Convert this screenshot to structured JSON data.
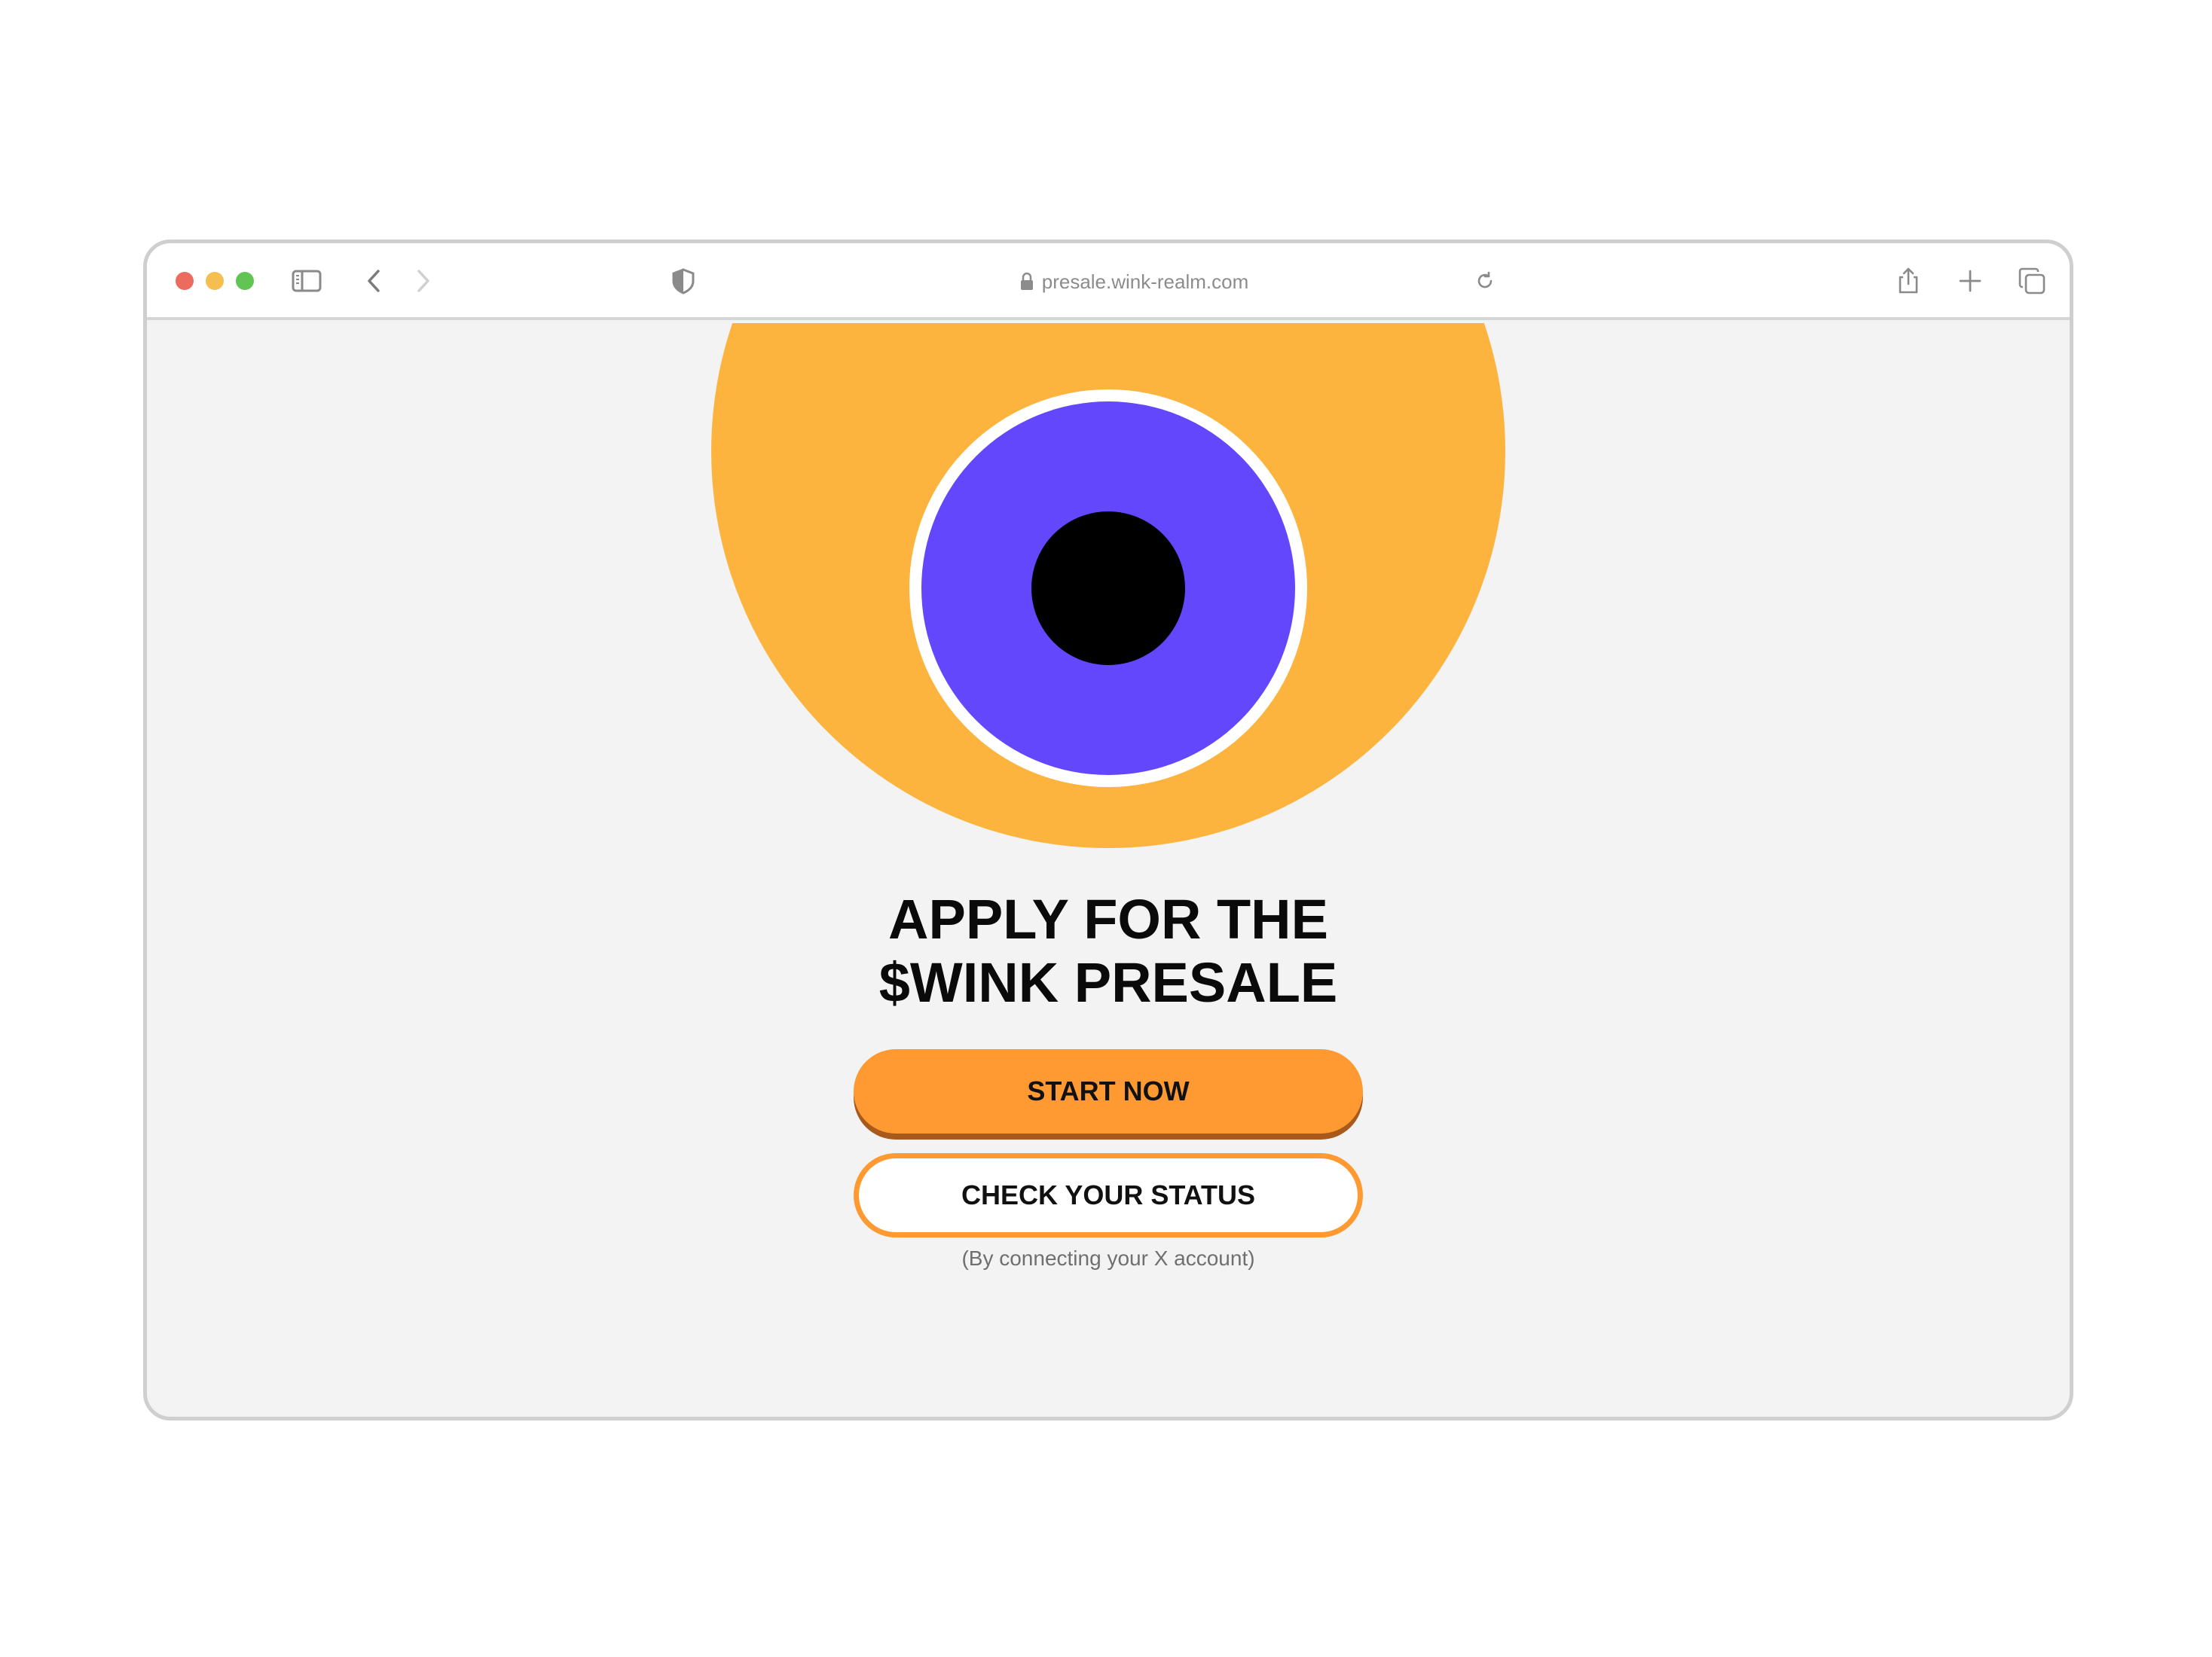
{
  "browser": {
    "url": "presale.wink-realm.com",
    "icons": [
      "sidebar-icon",
      "back-icon",
      "forward-icon",
      "shield-icon",
      "lock-icon",
      "reload-icon",
      "share-icon",
      "new-tab-icon",
      "tabs-icon"
    ]
  },
  "hero": {
    "colors": {
      "outer": "#fdb43f",
      "ring": "#ffffff",
      "iris": "#6347fc",
      "pupil": "#000000",
      "background": "#f3f3f3"
    }
  },
  "main": {
    "headline_line1": "APPLY FOR THE",
    "headline_line2": "$WINK PRESALE",
    "start_button": "START NOW",
    "status_button": "CHECK YOUR STATUS",
    "note": "(By connecting your X account)",
    "accent_color": "#ff9a33"
  }
}
